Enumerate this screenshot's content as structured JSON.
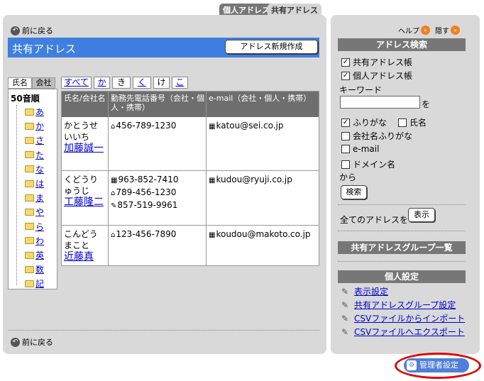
{
  "tabs": {
    "personal": "個人アドレス",
    "shared": "共有アドレス"
  },
  "nav": {
    "back_top": "前に戻る",
    "back_bottom": "前に戻る"
  },
  "title": {
    "text": "共有アドレス",
    "new_button": "アドレス新規作成"
  },
  "index": {
    "tab_name": "氏名",
    "tab_company": "会社",
    "heading": "50音順",
    "items": [
      "あ",
      "か",
      "さ",
      "た",
      "な",
      "は",
      "ま",
      "や",
      "ら",
      "わ",
      "英",
      "数",
      "記"
    ]
  },
  "kana_tabs": [
    "すべて",
    "か",
    "き",
    "く",
    "け",
    "こ"
  ],
  "table": {
    "headers": [
      "氏名/会社名",
      "勤務先電話番号（会社・個人・携帯）",
      "e-mail（会社・個人・携帯）"
    ],
    "rows": [
      {
        "kana": "かとうせいいち",
        "name": "加藤誠一",
        "phones": [
          "456-789-1230"
        ],
        "email": "katou@sei.co.jp"
      },
      {
        "kana": "くどうりゅうじ",
        "name": "工藤隆二",
        "phones": [
          "963-852-7410",
          "789-456-1230",
          "857-519-9961"
        ],
        "email": "kudou@ryuji.co.jp"
      },
      {
        "kana": "こんどうまこと",
        "name": "近藤真",
        "phones": [
          "123-456-7890"
        ],
        "email": "koudou@makoto.co.jp"
      }
    ]
  },
  "right": {
    "help": "ヘルプ",
    "hide": "隠す",
    "search_heading": "アドレス検索",
    "shared_book": "共有アドレス帳",
    "personal_book": "個人アドレス帳",
    "keyword_label": "キーワード",
    "keyword_value": "",
    "wo": "を",
    "opt_furigana": "ふりがな",
    "opt_name": "氏名",
    "opt_company_furigana": "会社名ふりがな",
    "opt_email": "e-mail",
    "opt_domain": "ドメイン名",
    "kara": "から",
    "search_button": "検索",
    "all_addresses": "全てのアドレスを",
    "show_button": "表示",
    "group_heading": "共有アドレスグループ一覧",
    "personal_settings": "個人設定",
    "links": [
      "表示設定",
      "共有アドレスグループ設定",
      "CSVファイルからインポート",
      "CSVファイルへエクスポート"
    ]
  },
  "admin_button": "管理者設定"
}
